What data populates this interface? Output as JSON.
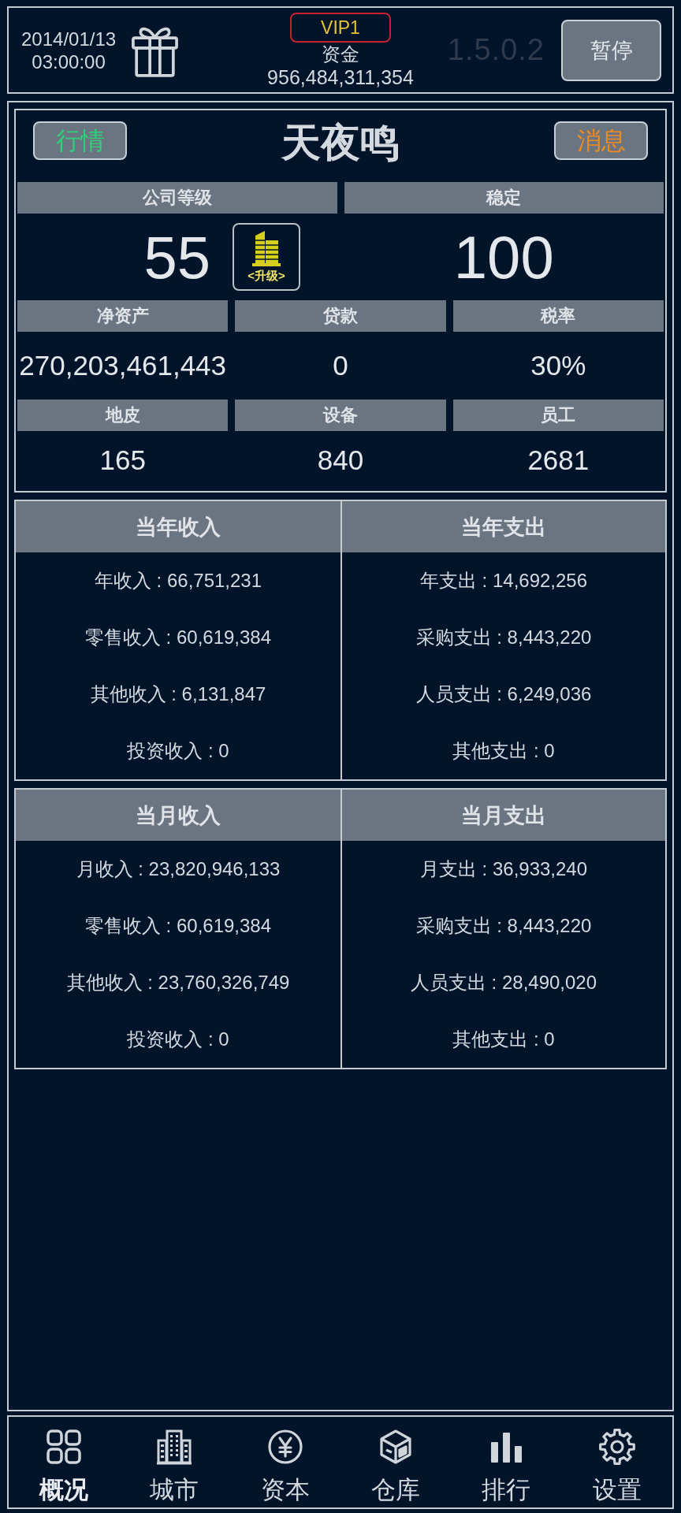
{
  "header": {
    "date": "2014/01/13",
    "time": "03:00:00",
    "vip_badge": "VIP1",
    "funds_label": "资金",
    "funds_value": "956,484,311,354",
    "version": "1.5.0.2",
    "pause_button": "暂停"
  },
  "company": {
    "market_button": "行情",
    "name": "天夜鸣",
    "messages_button": "消息",
    "stat_rows": [
      {
        "stats": [
          {
            "label": "公司等级",
            "value": "55",
            "upgrade_button": "<升级>"
          },
          {
            "label": "稳定",
            "value": "100"
          }
        ]
      },
      {
        "stats": [
          {
            "label": "净资产",
            "value": "270,203,461,443"
          },
          {
            "label": "贷款",
            "value": "0"
          },
          {
            "label": "税率",
            "value": "30%"
          }
        ]
      },
      {
        "stats": [
          {
            "label": "地皮",
            "value": "165"
          },
          {
            "label": "设备",
            "value": "840"
          },
          {
            "label": "员工",
            "value": "2681"
          }
        ]
      }
    ]
  },
  "finance_tables": [
    {
      "columns": [
        {
          "title": "当年收入",
          "lines": [
            "年收入 : 66,751,231",
            "零售收入 : 60,619,384",
            "其他收入 : 6,131,847",
            "投资收入 : 0"
          ]
        },
        {
          "title": "当年支出",
          "lines": [
            "年支出 : 14,692,256",
            "采购支出 : 8,443,220",
            "人员支出 : 6,249,036",
            "其他支出 : 0"
          ]
        }
      ]
    },
    {
      "columns": [
        {
          "title": "当月收入",
          "lines": [
            "月收入 : 23,820,946,133",
            "零售收入 : 60,619,384",
            "其他收入 : 23,760,326,749",
            "投资收入 : 0"
          ]
        },
        {
          "title": "当月支出",
          "lines": [
            "月支出 : 36,933,240",
            "采购支出 : 8,443,220",
            "人员支出 : 28,490,020",
            "其他支出 : 0"
          ]
        }
      ]
    }
  ],
  "nav_tabs": [
    {
      "label": "概况",
      "selected": true
    },
    {
      "label": "城市",
      "selected": false
    },
    {
      "label": "资本",
      "selected": false
    },
    {
      "label": "仓库",
      "selected": false
    },
    {
      "label": "排行",
      "selected": false
    },
    {
      "label": "设置",
      "selected": false
    }
  ]
}
